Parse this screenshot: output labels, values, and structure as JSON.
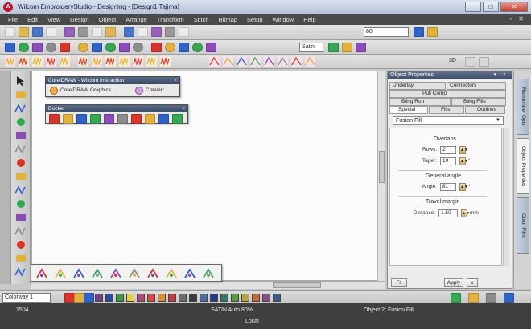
{
  "window": {
    "title": "Wilcom EmbroideryStudio - Designing - [Design1    Tajima]",
    "app_logo": "W",
    "minimize": "_",
    "maximize": "□",
    "close": "✕"
  },
  "menu": {
    "items": [
      "File",
      "Edit",
      "View",
      "Design",
      "Object",
      "Arrange",
      "Transform",
      "Stitch",
      "Bitmap",
      "Setup",
      "Window",
      "Help"
    ],
    "right_controls": "_ ▫ ✕"
  },
  "toolbar": {
    "zoom_value": "80",
    "fabric_value": "Satin",
    "colors": {
      "red": "#d9342b",
      "gold": "#e3b23c",
      "blue": "#2f63c8",
      "green": "#34a853",
      "purple": "#8c4bb8",
      "gray": "#8c8c8c"
    },
    "row1_icons": [
      "new-icon",
      "open-icon",
      "save-icon",
      "print-icon",
      "cut-icon",
      "copy-icon",
      "paste-icon",
      "undo-icon",
      "redo-icon",
      "zoom-in-icon",
      "zoom-out-icon",
      "grid-icon",
      "help-icon"
    ],
    "row2_icons": [
      "run-icon",
      "satin-icon",
      "fill-icon",
      "outline-icon",
      "star-icon",
      "cross-icon",
      "align-icon",
      "color-icon",
      "palette-icon",
      "lasso-icon",
      "pen-icon",
      "grid2-icon",
      "brush-icon",
      "eraser-icon",
      "spiral-icon"
    ],
    "row3_icons": [
      "ww-icon",
      "zigzag-icon",
      "stitch-icon",
      "hatch-icon",
      "applique-icon",
      "3d-icon",
      "lettering-icon",
      "monogram-icon",
      "border-icon",
      "weave-icon",
      "pattern-icon",
      "texture-icon"
    ],
    "row3_label_3d": "3D"
  },
  "float_corel": {
    "title": "CorelDRAW - Wilcom Interaction",
    "close": "×",
    "button1": "CorelDRAW Graphics",
    "button2": "Convert"
  },
  "float_docker": {
    "title": "Docker",
    "close": "×"
  },
  "tools_left": [
    "select-icon",
    "reshape-icon",
    "stitch-edit-icon",
    "circle-icon",
    "scissors-icon",
    "rectangle-icon",
    "run-icon",
    "satin-tool-icon",
    "fill-tool-icon",
    "lettering-icon",
    "monogram-icon",
    "appliqué-icon",
    "shape-icon",
    "color-wheel-icon",
    "palette-icon"
  ],
  "tools_bottom": [
    "auto-digitize-icon",
    "color-chip-icon",
    "vector-icon",
    "wand-icon",
    "stamp-icon",
    "stamp2-icon",
    "curve-icon",
    "pen-icon",
    "design-icon",
    "hand-icon"
  ],
  "properties": {
    "title": "Object Properties",
    "title_controls": "▾ ×",
    "tabs_row1": [
      "Underlay",
      "Connectors"
    ],
    "tabs_row2": [
      "Pull Comp"
    ],
    "tabs_row3": [
      "Bling Run",
      "Bling Fills"
    ],
    "tabs_row4": [
      "Special",
      "Fills",
      "Outlines"
    ],
    "fill_type": "Fusion Fill",
    "overlaps": {
      "heading": "Overlaps",
      "rows_label": "Rows:",
      "rows_value": "2",
      "taper_label": "Taper:",
      "taper_value": "10",
      "taper_unit": "°"
    },
    "general_angle": {
      "heading": "General angle",
      "angle_label": "Angle:",
      "angle_value": "81",
      "angle_unit": "°"
    },
    "travel_margin": {
      "heading": "Travel margin",
      "distance_label": "Distance:",
      "distance_value": "1.50",
      "distance_unit": "mm"
    },
    "button_fit": "Fit",
    "button_apply": "Apply",
    "button_x": "x"
  },
  "side_tabs": [
    "Remember Opts",
    "Object Properties",
    "Color Film"
  ],
  "colorbar": {
    "palette_select": "Colorway 1",
    "swatches": [
      "#7a3e8c",
      "#2a4b9b",
      "#3a9a4a",
      "#e3d23a",
      "#b0457a",
      "#d94a3a",
      "#e08a2e",
      "#c23b3b",
      "#6b6b6b",
      "#3a3a3a",
      "#4a6aa8",
      "#28388a",
      "#2a7a6a",
      "#5a9a3a",
      "#b8a23a",
      "#c46a3a",
      "#8a4a8a",
      "#3a5a8a"
    ]
  },
  "status": {
    "left": "1504",
    "center": "SATIN Auto 80%",
    "right": "Object 2: Fusion Fill",
    "sub": "Local"
  }
}
